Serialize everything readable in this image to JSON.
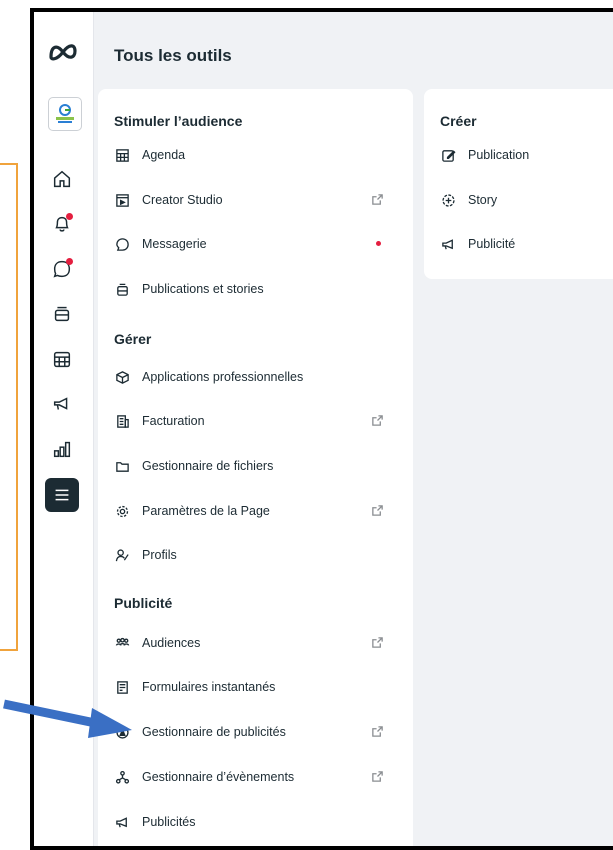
{
  "page_title": "Tous les outils",
  "colors": {
    "accent_blue": "#3a6fc4",
    "notification": "#e41e3f",
    "frame_orange": "#f0a33c"
  },
  "rail": {
    "icons": [
      "meta-logo-icon",
      "page-avatar",
      "home-icon",
      "bell-icon",
      "chat-icon",
      "stack-icon",
      "table-icon",
      "megaphone-icon",
      "chart-icon",
      "menu-icon"
    ]
  },
  "tools": {
    "sections": [
      {
        "title": "Stimuler l’audience",
        "items": [
          {
            "label": "Agenda",
            "icon": "calendar-icon"
          },
          {
            "label": "Creator Studio",
            "icon": "video-icon",
            "external": true
          },
          {
            "label": "Messagerie",
            "icon": "chat-icon",
            "notification": true
          },
          {
            "label": "Publications et stories",
            "icon": "stack-icon"
          }
        ]
      },
      {
        "title": "Gérer",
        "items": [
          {
            "label": "Applications professionnelles",
            "icon": "cube-icon"
          },
          {
            "label": "Facturation",
            "icon": "billing-icon",
            "external": true
          },
          {
            "label": "Gestionnaire de fichiers",
            "icon": "folder-icon"
          },
          {
            "label": "Paramètres de la Page",
            "icon": "gear-icon",
            "external": true
          },
          {
            "label": "Profils",
            "icon": "profile-icon"
          }
        ]
      },
      {
        "title": "Publicité",
        "items": [
          {
            "label": "Audiences",
            "icon": "people-icon",
            "external": true
          },
          {
            "label": "Formulaires instantanés",
            "icon": "form-icon"
          },
          {
            "label": "Gestionnaire de publicités",
            "icon": "ads-manager-icon",
            "external": true
          },
          {
            "label": "Gestionnaire d’évènements",
            "icon": "events-icon",
            "external": true
          },
          {
            "label": "Publicités",
            "icon": "megaphone-icon"
          }
        ]
      }
    ]
  },
  "create": {
    "title": "Créer",
    "items": [
      {
        "label": "Publication",
        "icon": "edit-icon"
      },
      {
        "label": "Story",
        "icon": "story-plus-icon"
      },
      {
        "label": "Publicité",
        "icon": "megaphone-icon"
      }
    ]
  }
}
